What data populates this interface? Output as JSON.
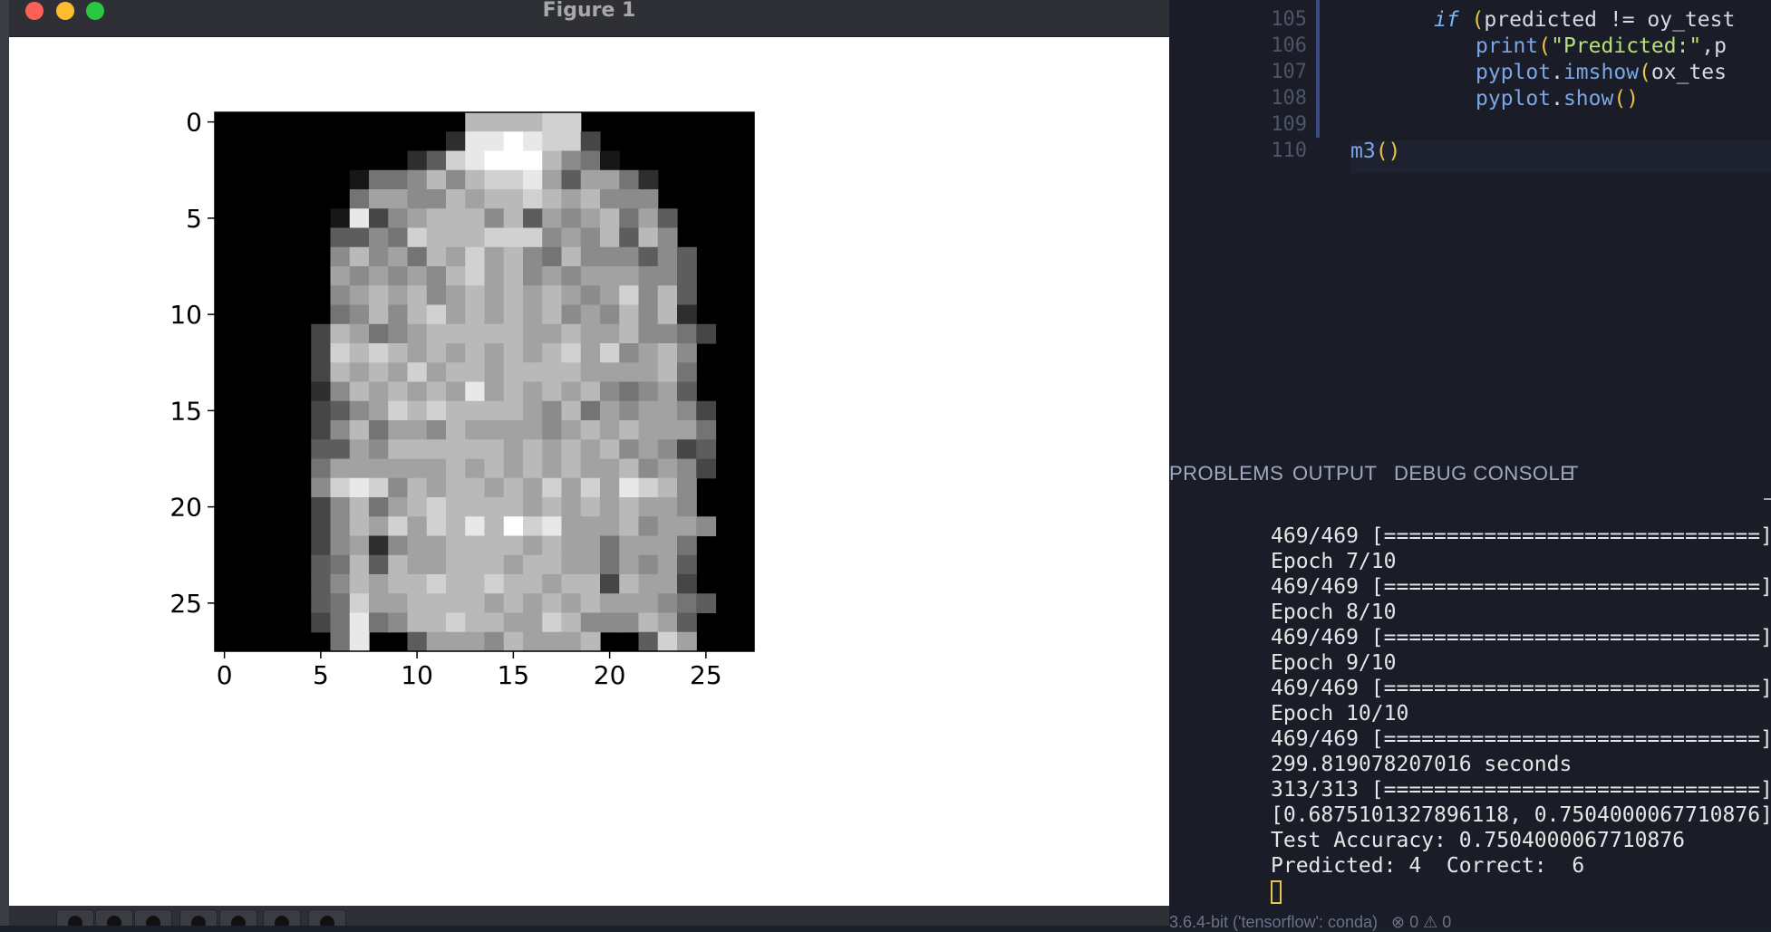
{
  "figure_window": {
    "title": "Figure 1",
    "traffic_lights": {
      "close": "#fe5f57",
      "minimize": "#febc2e",
      "maximize": "#28c840"
    }
  },
  "chart_data": {
    "type": "heatmap",
    "colormap": "gray",
    "grid": false,
    "xlim": [
      -0.5,
      27.5
    ],
    "ylim": [
      27.5,
      -0.5
    ],
    "xticks": [
      0,
      5,
      10,
      15,
      20,
      25
    ],
    "yticks": [
      0,
      5,
      10,
      15,
      20,
      25
    ],
    "rows": [
      "0000000000000888899000000000",
      "0000000000002aaba99300000000",
      "0000000000249abcb86510000000",
      "0000000155686899a7477520000000",
      "0000000577668788987866600000",
      "0000001a3678886847678574000000",
      "0000004465988899967684860000",
      "0000006867587978658666464000",
      "0000007676768978676777664000",
      "0000006787867878787679684000",
      "0000005686897878786768682000",
      "00000387567888887787786653000",
      "0000039898787878789796786000",
      "0000038787978878888777785000",
      "0000026878787a78787865674000",
      "0000034679898888768576776300",
      "0000036857768777767878777500",
      "0000044768888887878786763400",
      "00000577777787878787786763000",
      "0000069a9687887879797a986000",
      "0000036857898888787878776000",
      "0000036879798a8b9a77786776000",
      "0000036726778888787757775000",
      "0000045848778887887757674000",
      "0000046878898898878838773000",
      "00000459778888787878777654000",
      "0000035a56889887798666874000",
      "0000005a00477768777800497000"
    ]
  },
  "editor": {
    "lines": [
      {
        "num": "105",
        "indent": 2,
        "tokens": [
          {
            "t": "if",
            "c": "kw"
          },
          {
            "t": " (",
            "c": "par"
          },
          {
            "t": "predicted",
            "c": "var"
          },
          {
            "t": " != ",
            "c": "op"
          },
          {
            "t": "oy_test",
            "c": "var"
          }
        ]
      },
      {
        "num": "106",
        "indent": 3,
        "tokens": [
          {
            "t": "print",
            "c": "fn"
          },
          {
            "t": "(",
            "c": "par"
          },
          {
            "t": "\"Predicted:\"",
            "c": "str"
          },
          {
            "t": ",",
            "c": "op"
          },
          {
            "t": "p",
            "c": "var"
          }
        ]
      },
      {
        "num": "107",
        "indent": 3,
        "tokens": [
          {
            "t": "pyplot",
            "c": "fn"
          },
          {
            "t": ".",
            "c": "op"
          },
          {
            "t": "imshow",
            "c": "fn"
          },
          {
            "t": "(",
            "c": "par"
          },
          {
            "t": "ox_tes",
            "c": "var"
          }
        ]
      },
      {
        "num": "108",
        "indent": 3,
        "tokens": [
          {
            "t": "pyplot",
            "c": "fn"
          },
          {
            "t": ".",
            "c": "op"
          },
          {
            "t": "show",
            "c": "fn"
          },
          {
            "t": "()",
            "c": "par"
          }
        ]
      },
      {
        "num": "109",
        "indent": 0,
        "tokens": []
      },
      {
        "num": "110",
        "indent": 0,
        "tokens": [
          {
            "t": "m3",
            "c": "fn"
          },
          {
            "t": "()",
            "c": "par"
          }
        ]
      }
    ]
  },
  "panel": {
    "tabs": [
      "PROBLEMS",
      "OUTPUT",
      "DEBUG CONSOLE",
      "T"
    ]
  },
  "terminal": {
    "lines": [
      "469/469 [==============================]",
      "Epoch 7/10",
      "469/469 [==============================]",
      "Epoch 8/10",
      "469/469 [==============================]",
      "Epoch 9/10",
      "469/469 [==============================]",
      "Epoch 10/10",
      "469/469 [==============================]",
      "299.819078207016 seconds",
      "313/313 [==============================]",
      "[0.6875101327896118, 0.7504000067710876]",
      "Test Accuracy: 0.7504000067710876",
      "Predicted: 4  Correct:  6"
    ]
  },
  "status_bar": {
    "text": "3.6.4-bit ('tensorflow': conda)   ⊗ 0 ⚠ 0"
  }
}
